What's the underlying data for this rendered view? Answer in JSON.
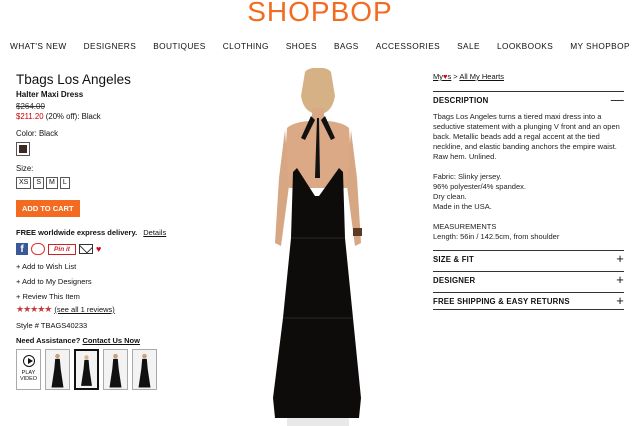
{
  "header": {
    "logo": "SHOPBOP",
    "nav": [
      "WHAT'S NEW",
      "DESIGNERS",
      "BOUTIQUES",
      "CLOTHING",
      "SHOES",
      "BAGS",
      "ACCESSORIES",
      "SALE",
      "LOOKBOOKS",
      "MY SHOPBOP"
    ]
  },
  "product": {
    "brand": "Tbags Los Angeles",
    "name": "Halter Maxi Dress",
    "original_price": "$264.00",
    "sale_price": "$211.20",
    "discount": "(20% off):",
    "color_selected": "Black",
    "color_label": "Color: Black",
    "size_label": "Size:",
    "sizes": [
      "XS",
      "S",
      "M",
      "L"
    ],
    "add_to_cart": "ADD TO CART",
    "shipping": "FREE worldwide express delivery.",
    "shipping_details": "Details",
    "pinit": "Pin it",
    "actions": [
      "+ Add to Wish List",
      "+ Add to My Designers",
      "+ Review This Item"
    ],
    "reviews_link": "(see all 1 reviews)",
    "rating": 5,
    "style": "Style # TBAGS40233",
    "assist": "Need Assistance?",
    "contact": "Contact Us Now",
    "play_video": "PLAY VIDEO",
    "swatch_color": "#3a2a22"
  },
  "right": {
    "my_label": "My",
    "hearts_sub": "s",
    "sep": ">",
    "all_hearts": "All My Hearts",
    "sections": [
      {
        "title": "DESCRIPTION",
        "toggle": "—"
      },
      {
        "title": "SIZE & FIT",
        "toggle": "+"
      },
      {
        "title": "DESIGNER",
        "toggle": "+"
      },
      {
        "title": "FREE SHIPPING & EASY RETURNS",
        "toggle": "+"
      }
    ],
    "description": "Tbags Los Angeles turns a tiered maxi dress into a seductive statement with a plunging V front and an open back. Metallic beads add a regal accent at the tied neckline, and elastic banding anchors the empire waist. Raw hem. Unlined.",
    "fabric": [
      "Fabric: Slinky jersey.",
      "96% polyester/4% spandex.",
      "Dry clean.",
      "Made in the USA."
    ],
    "measurements_title": "MEASUREMENTS",
    "measurements": "Length: 56in / 142.5cm, from shoulder"
  },
  "colors": {
    "accent": "#f26b21",
    "sale": "#cc0000",
    "heart": "#d0021b"
  }
}
